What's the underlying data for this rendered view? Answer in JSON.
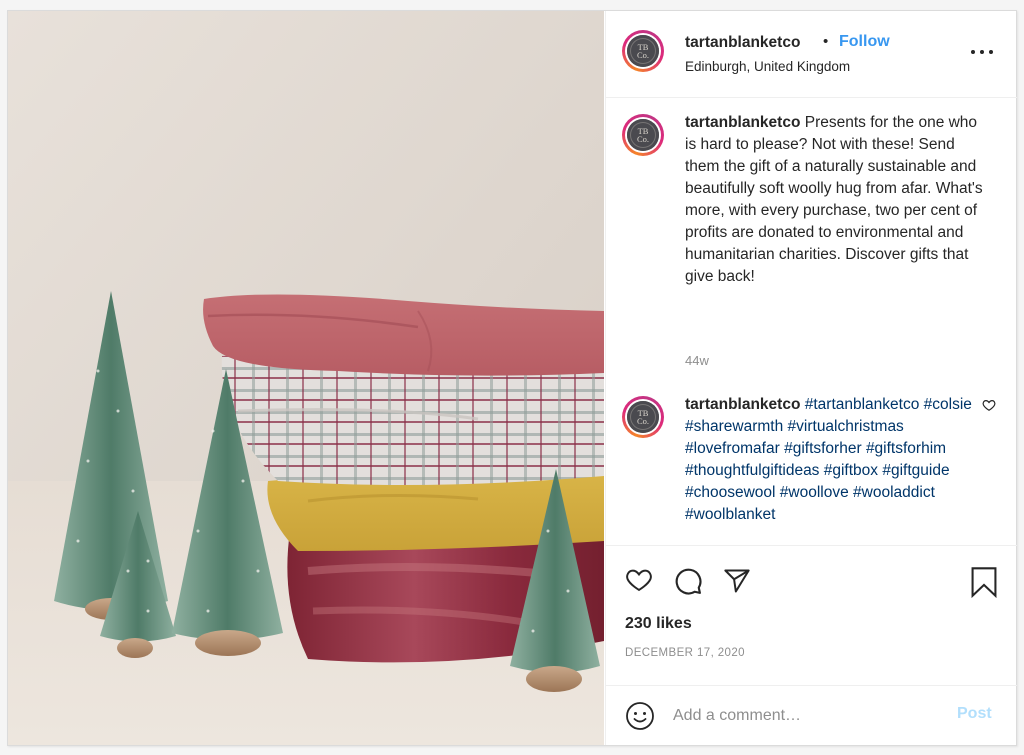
{
  "post": {
    "image_alt": "Stack of folded wool blankets (pink, tartan check, mustard, burgundy) beside miniature bottle-brush Christmas trees",
    "colors": {
      "follow": "#3897f0",
      "hashtag": "#003569",
      "post_disabled": "#b2dffc",
      "text": "#262626",
      "muted": "#8e8e8e"
    }
  },
  "header": {
    "avatar_text_line1": "TB",
    "avatar_text_line2": "Co.",
    "username": "tartanblanketco",
    "separator": "•",
    "follow_label": "Follow",
    "location": "Edinburgh, United Kingdom",
    "more_icon": "more-options-icon"
  },
  "caption": {
    "username": "tartanblanketco",
    "text": " Presents for the one who is hard to please? Not with these! Send them the gift of a naturally sustainable and beautifully soft woolly hug from afar. What's more, with every purchase, two per cent of profits are donated to environmental and humanitarian charities. Discover gifts that give back!",
    "age": "44w"
  },
  "comments": [
    {
      "username": "tartanblanketco",
      "hashtags": [
        "#tartanblanketco",
        "#colsie",
        "#sharewarmth",
        "#virtualchristmas",
        "#lovefromafar",
        "#giftsforher",
        "#giftsforhim",
        "#thoughtfulgiftideas",
        "#giftbox",
        "#giftguide",
        "#choosewool",
        "#woollove",
        "#wooladdict",
        "#woolblanket"
      ],
      "like_icon": "heart-icon"
    }
  ],
  "actions": {
    "like_icon": "heart-icon",
    "comment_icon": "comment-icon",
    "share_icon": "share-icon",
    "save_icon": "bookmark-icon",
    "likes": "230 likes",
    "date": "DECEMBER 17, 2020"
  },
  "comment_box": {
    "emoji_icon": "emoji-icon",
    "placeholder": "Add a comment…",
    "value": "",
    "post_label": "Post"
  }
}
